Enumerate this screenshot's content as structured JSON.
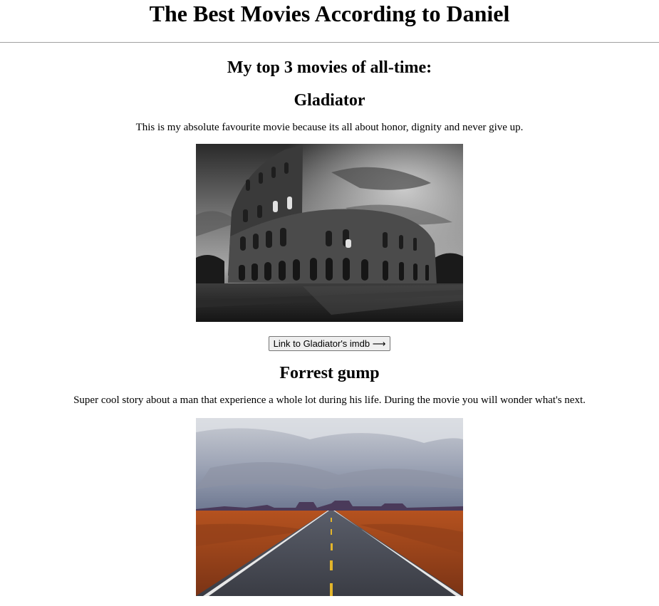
{
  "header": {
    "title": "The Best Movies According to Daniel"
  },
  "main": {
    "section_heading": "My top 3 movies of all-time:",
    "movies": [
      {
        "title": "Gladiator",
        "description": "This is my absolute favourite movie because its all about honor, dignity and never give up.",
        "button_label": "Link to Gladiator's imdb ⟶"
      },
      {
        "title": "Forrest gump",
        "description": "Super cool story about a man that experience a whole lot during his life. During the movie you will wonder what's next."
      }
    ]
  }
}
